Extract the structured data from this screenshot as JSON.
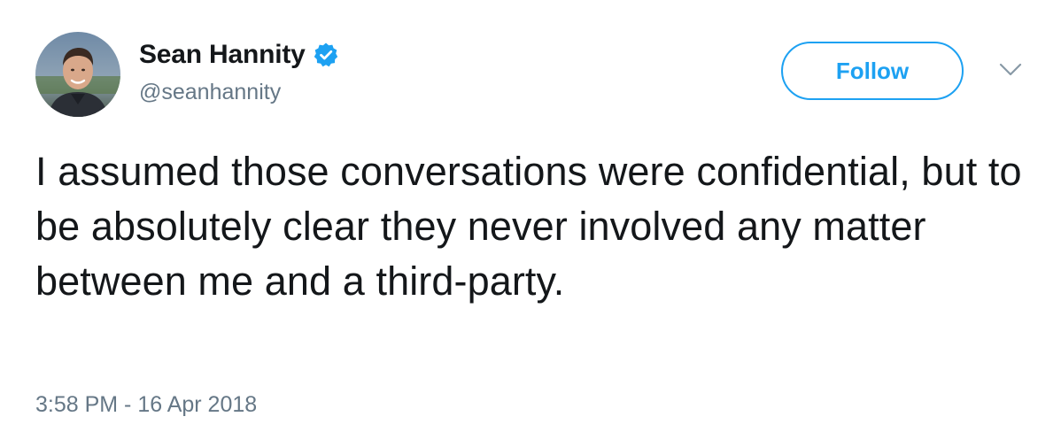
{
  "author": {
    "display_name": "Sean Hannity",
    "handle": "@seanhannity",
    "verified": true,
    "verified_icon": "verified-badge-icon",
    "avatar": "profile-photo"
  },
  "actions": {
    "follow_label": "Follow",
    "menu_icon": "chevron-down-icon"
  },
  "tweet": {
    "text": "I assumed those conversations were confidential, but to be absolutely clear they never involved any matter between me and a third-party.",
    "timestamp": "3:58 PM - 16 Apr 2018"
  },
  "colors": {
    "accent": "#1da1f2",
    "text_primary": "#14171a",
    "text_secondary": "#657786"
  }
}
